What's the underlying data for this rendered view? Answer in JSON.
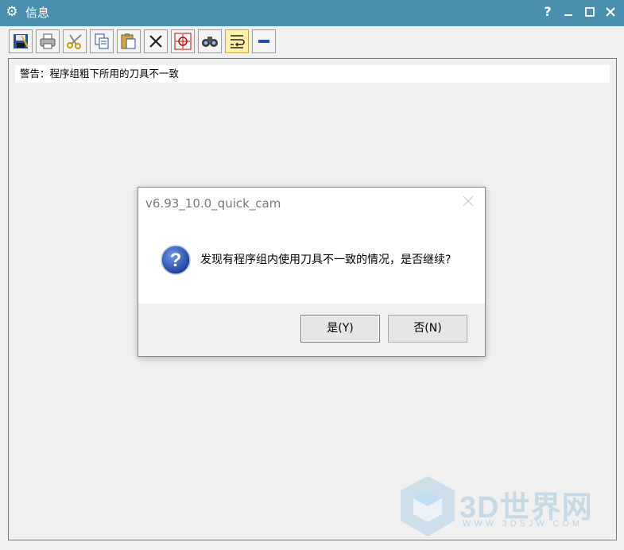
{
  "window": {
    "title": "信息",
    "help_label": "?",
    "minimize_label": "—",
    "close_label": "✕"
  },
  "toolbar": {
    "items": [
      {
        "name": "save-icon",
        "active": false
      },
      {
        "name": "print-icon",
        "active": false
      },
      {
        "name": "cut-icon",
        "active": false
      },
      {
        "name": "copy-icon",
        "active": false
      },
      {
        "name": "paste-icon",
        "active": false
      },
      {
        "name": "delete-icon",
        "active": false
      },
      {
        "name": "crosshair-icon",
        "active": false
      },
      {
        "name": "binoculars-icon",
        "active": false
      },
      {
        "name": "word-wrap-icon",
        "active": true
      },
      {
        "name": "minus-icon",
        "active": false
      }
    ]
  },
  "content": {
    "message": "警告：程序组粗下所用的刀具不一致"
  },
  "dialog": {
    "title": "v6.93_10.0_quick_cam",
    "close_label": "✕",
    "icon": "question-icon",
    "message": "发现有程序组内使用刀具不一致的情况，是否继续?",
    "yes_label": "是(Y)",
    "no_label": "否(N)"
  },
  "watermark": {
    "text": "3D世界网",
    "subtext": "WWW.3DSJW.COM"
  },
  "colors": {
    "titlebar": "#4a90ae",
    "accent": "#2a5bb8"
  }
}
